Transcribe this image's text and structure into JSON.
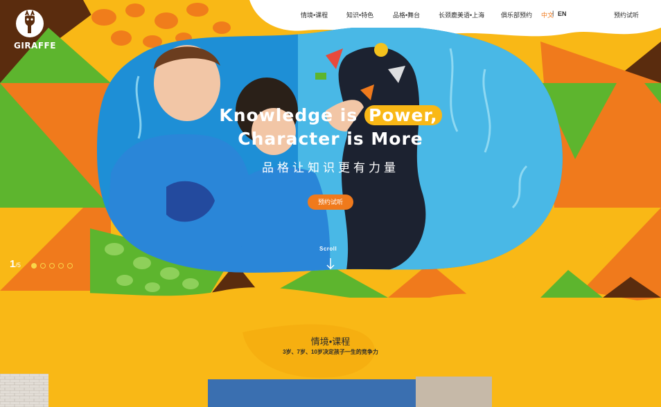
{
  "brand": {
    "name": "GIRAFFE"
  },
  "nav": {
    "items": [
      "情境•课程",
      "知识•特色",
      "品格•舞台",
      "长颈鹿美语•上海",
      "俱乐部预约"
    ],
    "lang_zh": "中文",
    "lang_sep": "|",
    "lang_en": "EN",
    "book": "预约试听"
  },
  "hero": {
    "line1_prefix": "Knowledge is ",
    "line1_highlight": "Power,",
    "line2": "Character is More",
    "subtitle": "品格让知识更有力量",
    "cta": "预约试听",
    "scroll": "Scroll"
  },
  "slider": {
    "current": "1",
    "total": "/5",
    "slides": 5,
    "active_index": 0
  },
  "section": {
    "title": "情境•课程",
    "subtitle": "3岁、7岁、10岁决定孩子一生的竞争力"
  },
  "colors": {
    "yellow": "#f9b816",
    "orange": "#f07a1c",
    "green": "#5db52e",
    "brown": "#5a2c0e",
    "blue": "#1e8fd6",
    "lightblue": "#49b8e6"
  }
}
